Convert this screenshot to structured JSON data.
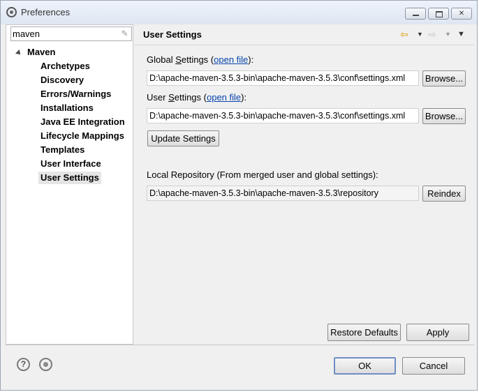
{
  "window": {
    "title": "Preferences"
  },
  "filter": {
    "value": "maven"
  },
  "tree": {
    "root": "Maven",
    "items": [
      {
        "label": "Archetypes"
      },
      {
        "label": "Discovery"
      },
      {
        "label": "Errors/Warnings"
      },
      {
        "label": "Installations"
      },
      {
        "label": "Java EE Integration"
      },
      {
        "label": "Lifecycle Mappings"
      },
      {
        "label": "Templates"
      },
      {
        "label": "User Interface"
      },
      {
        "label": "User Settings",
        "selected": true
      }
    ]
  },
  "page": {
    "title": "User Settings",
    "global": {
      "label_prefix": "Global ",
      "label_accel": "S",
      "label_rest": "ettings (",
      "link": "open file",
      "label_end": "):",
      "path": "D:\\apache-maven-3.5.3-bin\\apache-maven-3.5.3\\conf\\settings.xml",
      "browse": "Browse..."
    },
    "user": {
      "label_prefix": "User ",
      "label_accel": "S",
      "label_rest": "ettings (",
      "link": "open file",
      "label_end": "):",
      "path": "D:\\apache-maven-3.5.3-bin\\apache-maven-3.5.3\\conf\\settings.xml",
      "browse": "Browse..."
    },
    "update_settings": "Update Settings",
    "local_repo": {
      "label": "Local Repository (From merged user and global settings):",
      "path": "D:\\apache-maven-3.5.3-bin\\apache-maven-3.5.3\\repository",
      "reindex": "Reindex"
    },
    "restore_defaults": "Restore Defaults",
    "apply": "Apply"
  },
  "footer": {
    "ok": "OK",
    "cancel": "Cancel",
    "help_glyph": "?"
  },
  "icons": {
    "back": "back-arrow-icon",
    "forward": "forward-arrow-icon",
    "menu": "view-menu-icon"
  },
  "colors": {
    "link": "#0645ad",
    "back_arrow": "#e0a010",
    "selection": "#e5e5e5"
  }
}
